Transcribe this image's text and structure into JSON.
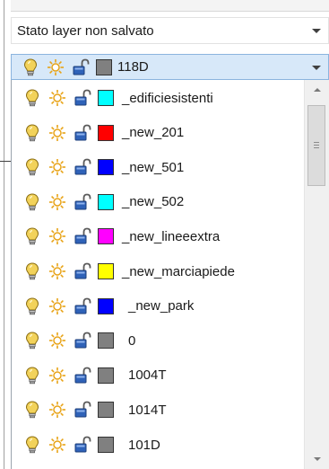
{
  "state_combo": {
    "text": "Stato layer non salvato"
  },
  "current_layer": {
    "name": "118D",
    "color": "#808080"
  },
  "icon_colors": {
    "bulb": "#f2d25a",
    "sun": "#e8a317",
    "lock": "#2f62b8"
  },
  "layers": [
    {
      "name": "_edificiesistenti",
      "color": "#00ffff"
    },
    {
      "name": "_new_201",
      "color": "#ff0000"
    },
    {
      "name": "_new_501",
      "color": "#0000ff"
    },
    {
      "name": "_new_502",
      "color": "#00ffff"
    },
    {
      "name": "_new_lineeextra",
      "color": "#ff00ff"
    },
    {
      "name": "_new_marciapiede",
      "color": "#ffff00"
    },
    {
      "name": "_new_park",
      "color": "#0000ff"
    },
    {
      "name": "0",
      "color": "#808080"
    },
    {
      "name": "1004T",
      "color": "#808080"
    },
    {
      "name": "1014T",
      "color": "#808080"
    },
    {
      "name": "101D",
      "color": "#808080"
    }
  ]
}
